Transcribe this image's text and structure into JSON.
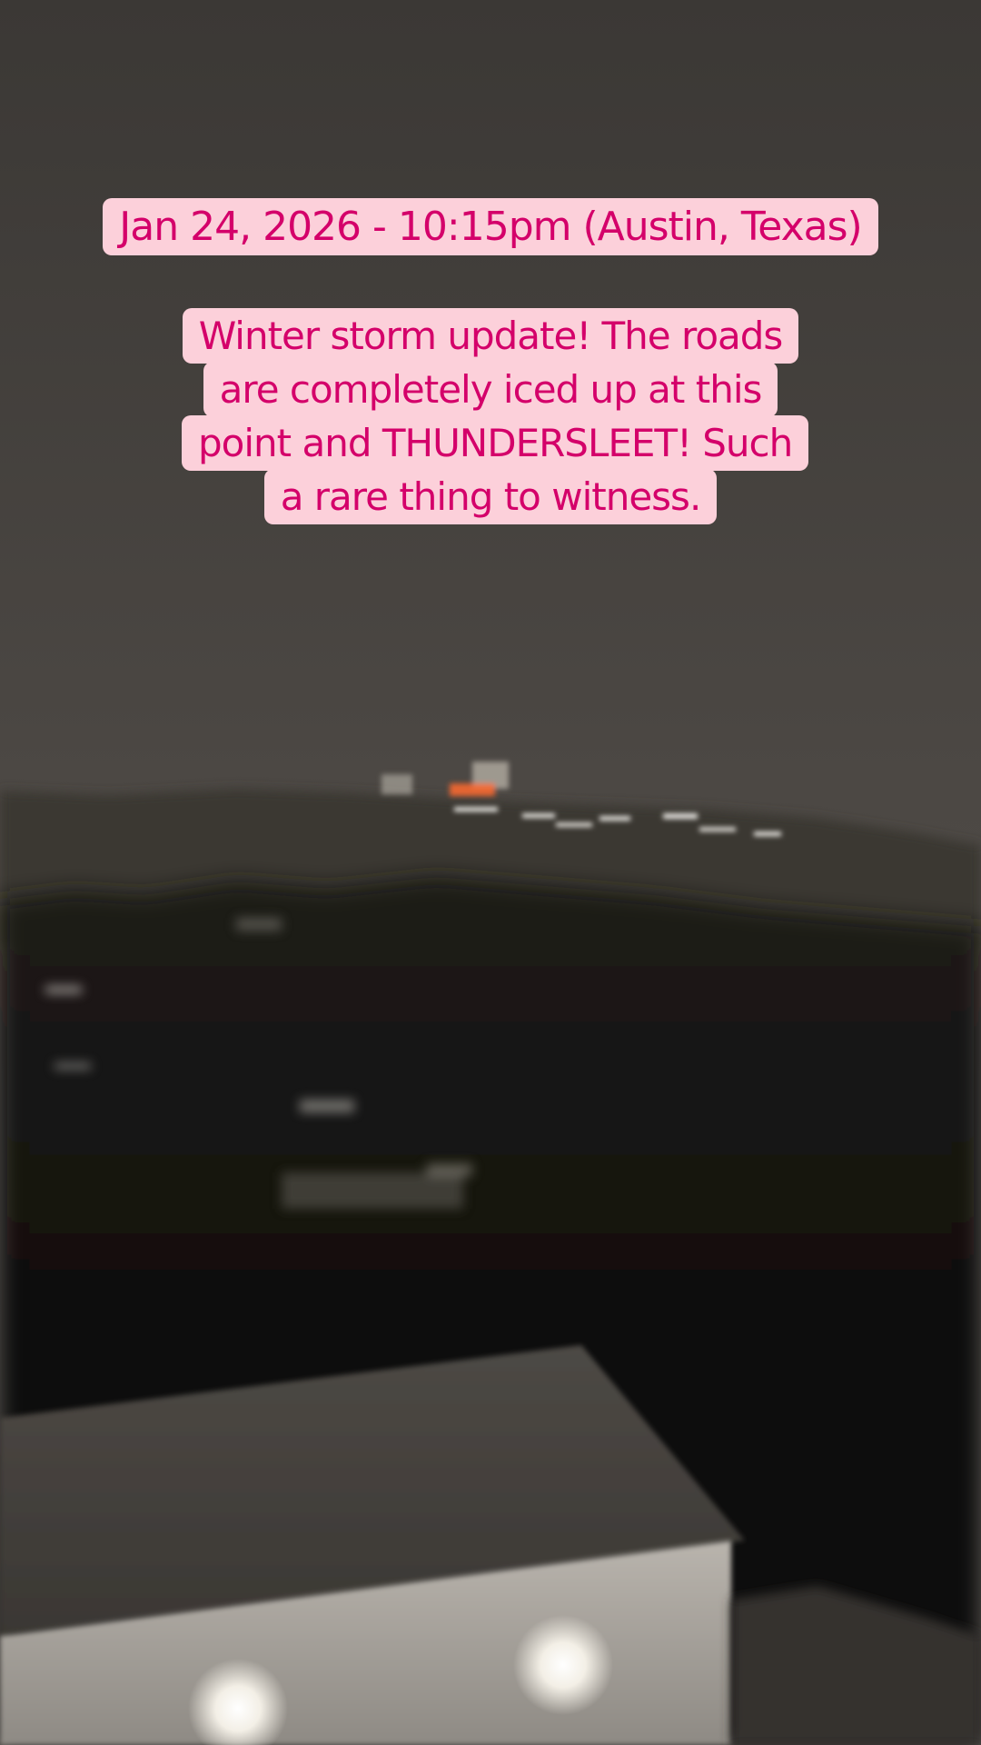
{
  "captions": {
    "date_location": "Jan 24, 2026 - 10:15pm (Austin, Texas)",
    "message": "Winter storm update! The roads are completely iced up at this point and THUNDERSLEET! Such a rare thing to witness."
  },
  "colors": {
    "caption_background": "#fcd0da",
    "caption_text": "#d4006a",
    "sky": "#4a4642",
    "foreground": "#0f0e0c"
  }
}
